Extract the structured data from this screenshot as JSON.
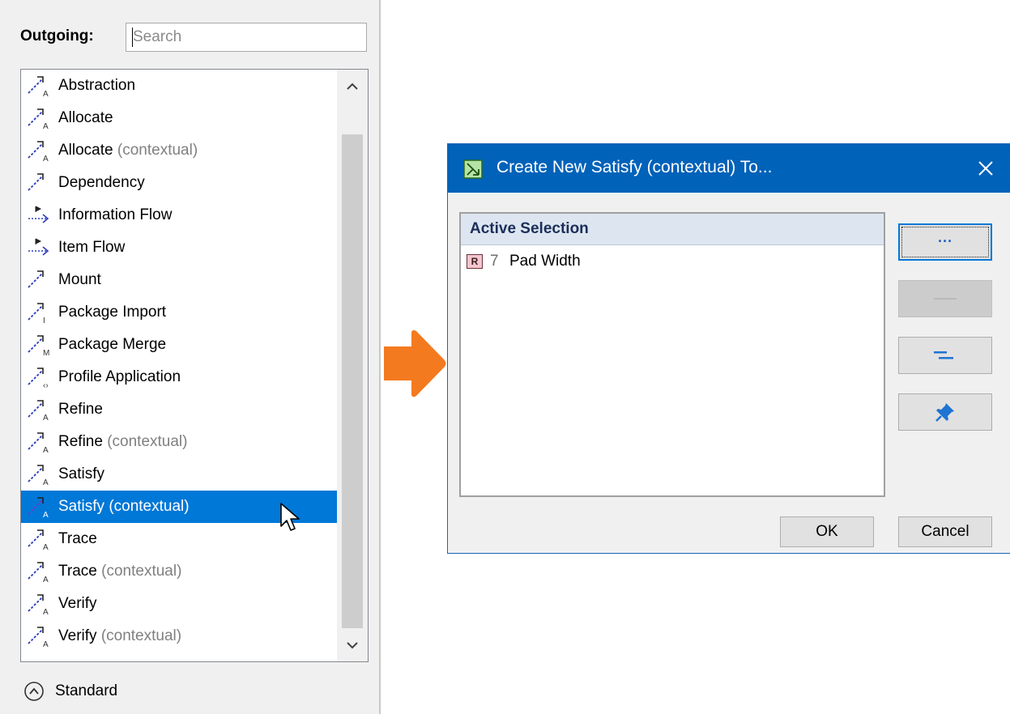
{
  "panel": {
    "outgoing_label": "Outgoing:",
    "search_placeholder": "Search",
    "items": [
      {
        "label": "Abstraction",
        "suffix": "",
        "icon": "abstraction-icon"
      },
      {
        "label": "Allocate",
        "suffix": "",
        "icon": "allocate-icon"
      },
      {
        "label": "Allocate",
        "suffix": "(contextual)",
        "icon": "allocate-icon"
      },
      {
        "label": "Dependency",
        "suffix": "",
        "icon": "dependency-icon"
      },
      {
        "label": "Information Flow",
        "suffix": "",
        "icon": "information-flow-icon"
      },
      {
        "label": "Item Flow",
        "suffix": "",
        "icon": "item-flow-icon"
      },
      {
        "label": "Mount",
        "suffix": "",
        "icon": "mount-icon"
      },
      {
        "label": "Package Import",
        "suffix": "",
        "icon": "package-import-icon"
      },
      {
        "label": "Package Merge",
        "suffix": "",
        "icon": "package-merge-icon"
      },
      {
        "label": "Profile Application",
        "suffix": "",
        "icon": "profile-application-icon"
      },
      {
        "label": "Refine",
        "suffix": "",
        "icon": "refine-icon"
      },
      {
        "label": "Refine",
        "suffix": "(contextual)",
        "icon": "refine-icon"
      },
      {
        "label": "Satisfy",
        "suffix": "",
        "icon": "satisfy-icon"
      },
      {
        "label": "Satisfy",
        "suffix": "(contextual)",
        "icon": "satisfy-icon",
        "selected": true
      },
      {
        "label": "Trace",
        "suffix": "",
        "icon": "trace-icon"
      },
      {
        "label": "Trace",
        "suffix": "(contextual)",
        "icon": "trace-icon"
      },
      {
        "label": "Verify",
        "suffix": "",
        "icon": "verify-icon"
      },
      {
        "label": "Verify",
        "suffix": "(contextual)",
        "icon": "verify-icon"
      }
    ],
    "standard_label": "Standard"
  },
  "dialog": {
    "title": "Create New Satisfy (contextual) To...",
    "list_header": "Active Selection",
    "selection": {
      "badge": "R",
      "number": "7",
      "name": "Pad Width"
    },
    "browse_label": "···",
    "ok_label": "OK",
    "cancel_label": "Cancel"
  },
  "colors": {
    "selection": "#0078d7",
    "titlebar": "#0062b9",
    "arrow": "#f47a20",
    "icon_blue": "#2b3bbd"
  }
}
